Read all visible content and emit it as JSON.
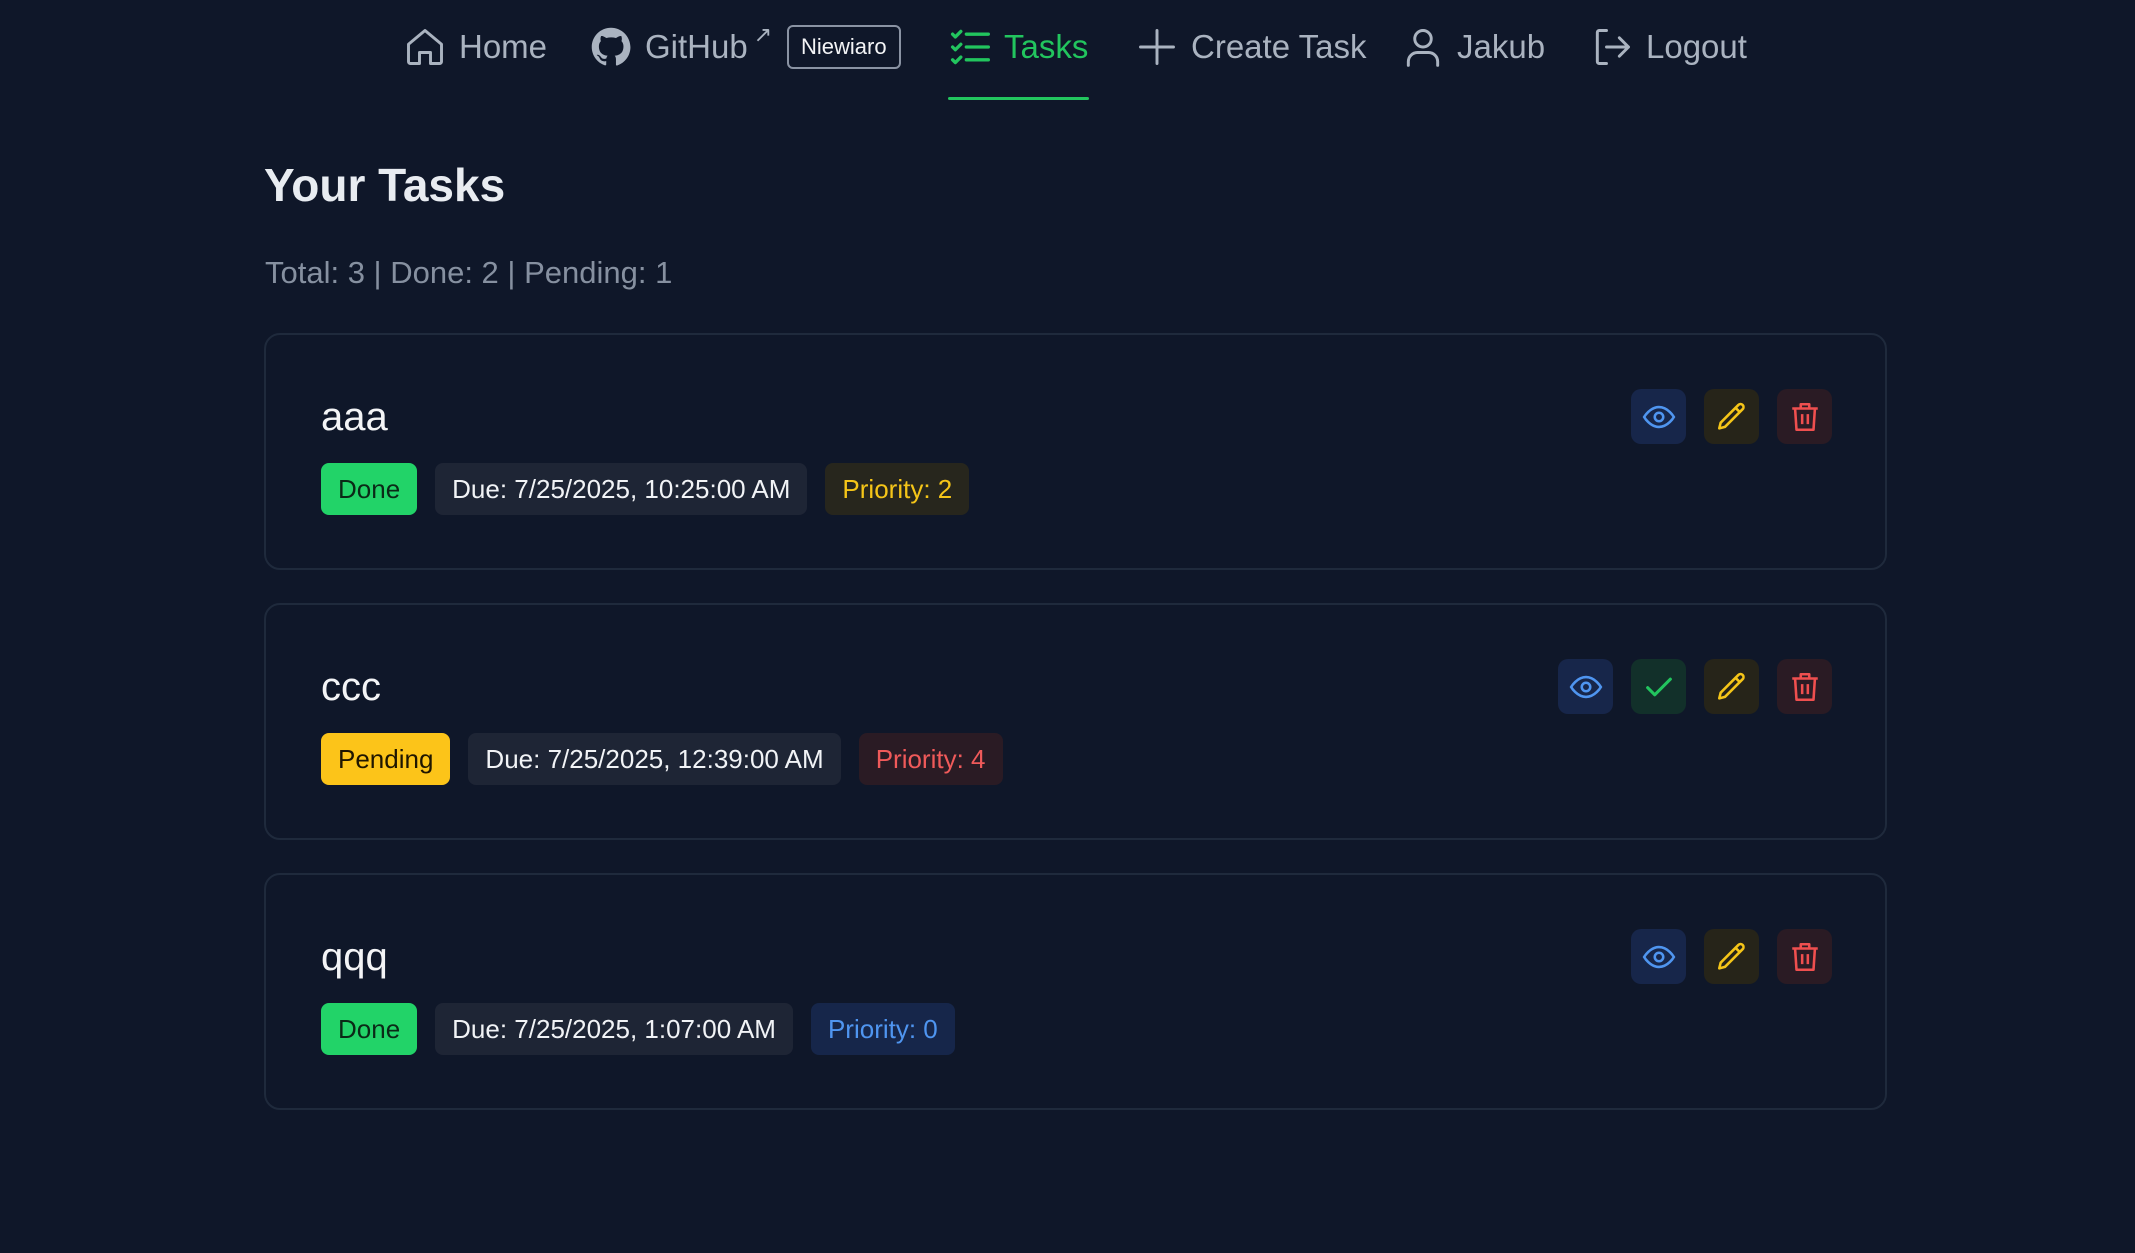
{
  "nav": {
    "home": "Home",
    "github": "GitHub",
    "github_ext": "↗",
    "user_badge": "Niewiaro",
    "tasks": "Tasks",
    "create": "Create Task",
    "user": "Jakub",
    "logout": "Logout"
  },
  "page": {
    "title": "Your Tasks",
    "stats": "Total: 3 | Done: 2 | Pending: 1"
  },
  "tasks": [
    {
      "title": "aaa",
      "status": "Done",
      "due": "Due: 7/25/2025, 10:25:00 AM",
      "priority": "Priority: 2"
    },
    {
      "title": "ccc",
      "status": "Pending",
      "due": "Due: 7/25/2025, 12:39:00 AM",
      "priority": "Priority: 4"
    },
    {
      "title": "qqq",
      "status": "Done",
      "due": "Due: 7/25/2025, 1:07:00 AM",
      "priority": "Priority: 0"
    }
  ],
  "colors": {
    "background": "#0f1729",
    "accent": "#22c55e",
    "done": "#22d368",
    "pending": "#fcc419",
    "priority_low": "#4f95f0",
    "priority_mid": "#f5c518",
    "priority_high": "#f05a5a"
  }
}
